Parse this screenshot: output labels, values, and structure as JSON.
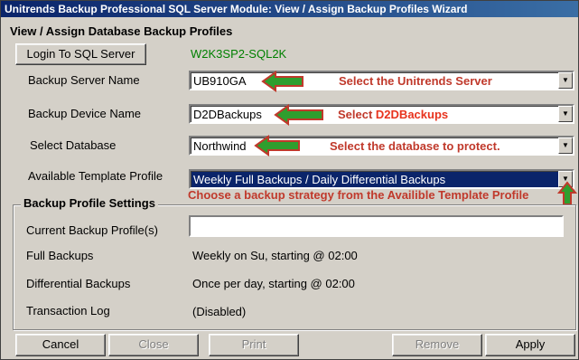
{
  "window": {
    "title": "Unitrends Backup Professional SQL Server Module: View / Assign Backup Profiles Wizard"
  },
  "heading": "View / Assign Database Backup Profiles",
  "login_button": "Login To SQL Server",
  "server_instance": "W2K3SP2-SQL2K",
  "rows": {
    "backup_server": {
      "label": "Backup Server Name",
      "value": "UB910GA",
      "annotation": "Select the Unitrends Server"
    },
    "backup_device": {
      "label": "Backup Device Name",
      "value": "D2DBackups",
      "annotation_prefix": "Select ",
      "annotation_highlight": "D2DBackups"
    },
    "database": {
      "label": "Select Database",
      "value": "Northwind",
      "annotation": "Select the database to protect."
    },
    "template": {
      "label": "Available Template Profile",
      "value": "Weekly Full Backups / Daily Differential Backups",
      "annotation": "Choose a backup strategy from the Availible Template Profile"
    }
  },
  "profile_settings": {
    "title": "Backup Profile Settings",
    "current_label": "Current Backup Profile(s)",
    "current_value": "",
    "full_label": "Full Backups",
    "full_value": "Weekly on Su, starting @ 02:00",
    "diff_label": "Differential Backups",
    "diff_value": "Once per day, starting @ 02:00",
    "tlog_label": "Transaction Log",
    "tlog_value": "(Disabled)"
  },
  "buttons": {
    "cancel": "Cancel",
    "close": "Close",
    "print": "Print",
    "remove": "Remove",
    "apply": "Apply"
  },
  "colors": {
    "annotation_red": "#c0392b",
    "arrow_green": "#2e9e2e",
    "arrow_border": "#c0392b",
    "server_green": "#008000",
    "selection_blue": "#0a246a"
  }
}
